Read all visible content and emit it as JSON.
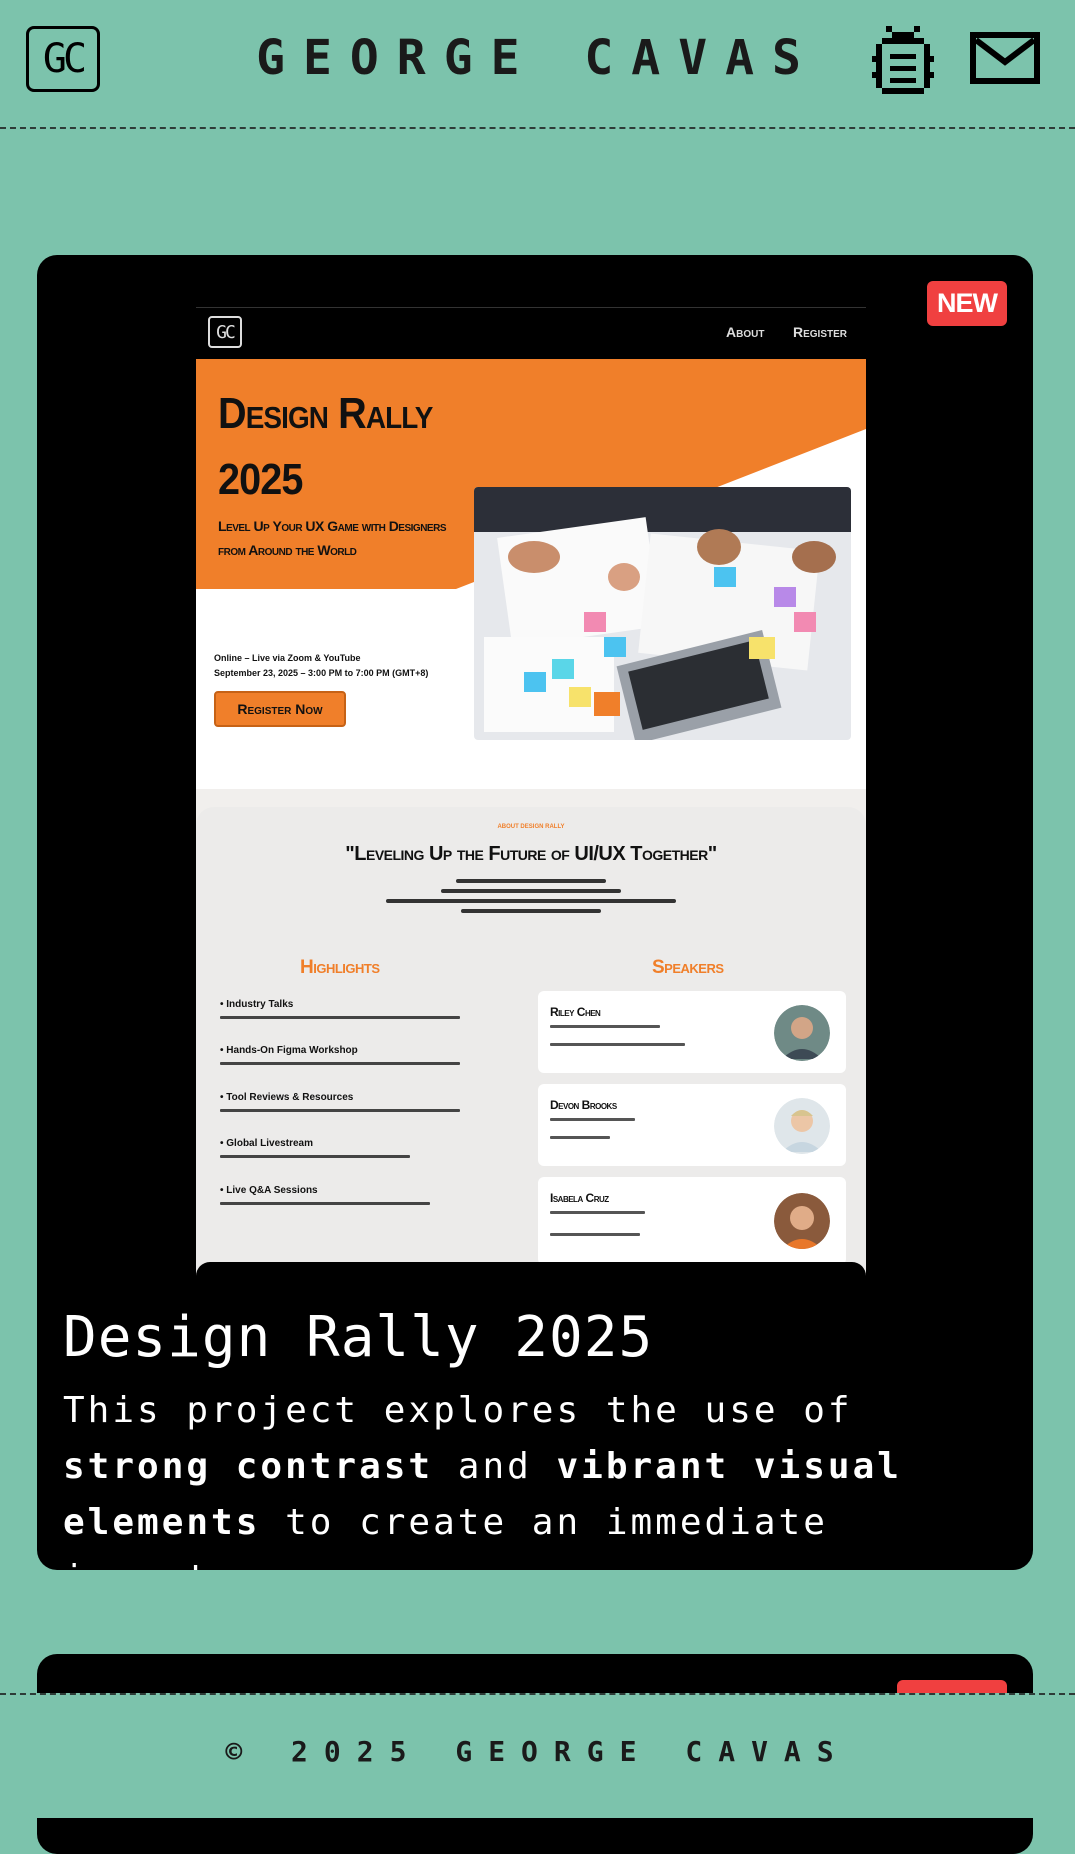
{
  "header": {
    "logo": "GC",
    "title": "GEORGE CAVAS",
    "icons": [
      "bug-icon",
      "mail-icon"
    ]
  },
  "project": {
    "badge": "NEW",
    "title": "Design Rally 2025",
    "description": {
      "p1": "This project explores the use of ",
      "b1": "strong contrast",
      "p2": " and ",
      "b2": "vibrant visual elements",
      "p3": " to create an immediate impact."
    },
    "preview": {
      "logo": "GC",
      "nav": [
        "About",
        "Register"
      ],
      "hero_title_line1": "Design Rally",
      "hero_title_line2": "2025",
      "hero_subtitle": "Level Up Your UX Game with Designers from Around the World",
      "meta_line1": "Online – Live via Zoom & YouTube",
      "meta_line2": "September 23, 2025 – 3:00 PM to 7:00 PM (GMT+8)",
      "cta": "Register Now",
      "kicker": "ABOUT DESIGN RALLY",
      "quote": "\"Leveling Up the Future of UI/UX Together\"",
      "highlights_title": "Highlights",
      "highlights": [
        "Industry Talks",
        "Hands-On Figma Workshop",
        "Tool Reviews & Resources",
        "Global Livestream",
        "Live Q&A Sessions"
      ],
      "speakers_title": "Speakers",
      "speakers": [
        "Riley Chen",
        "Devon Brooks",
        "Isabela Cruz"
      ]
    }
  },
  "footer": {
    "text": "© 2025 GEORGE CAVAS"
  },
  "colors": {
    "background": "#7cc3ac",
    "card": "#000000",
    "badge": "#f04040",
    "accent_orange": "#f07f2a"
  }
}
